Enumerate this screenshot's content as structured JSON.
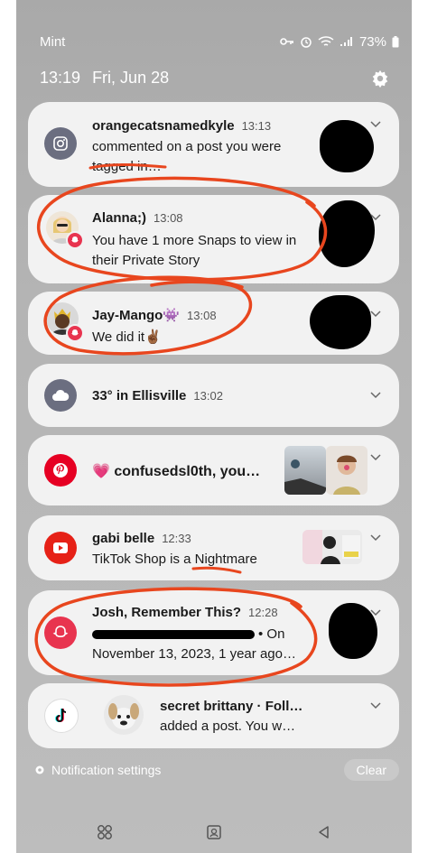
{
  "status_bar": {
    "carrier": "Mint",
    "battery": "73%"
  },
  "header": {
    "time": "13:19",
    "date": "Fri, Jun 28"
  },
  "notifications": [
    {
      "title": "orangecatsnamedkyle",
      "time": "13:13",
      "body": "commented on a post you were tagged in…",
      "app_icon": "instagram-icon"
    },
    {
      "title": "Alanna;)",
      "time": "13:08",
      "body": "You have 1 more Snaps to view in their Private Story",
      "app_icon": "snapchat-icon"
    },
    {
      "title": "Jay-Mango👾",
      "time": "13:08",
      "body": "We did it✌🏾",
      "app_icon": "snapchat-icon"
    },
    {
      "title": "33° in Ellisville",
      "time": "13:02",
      "body": "",
      "app_icon": "cloud-icon"
    },
    {
      "title": "💗 confusedsl0th, you…",
      "time": "",
      "body": "",
      "app_icon": "pinterest-icon"
    },
    {
      "title": "gabi belle",
      "time": "12:33",
      "body": "TikTok Shop is a Nightmare",
      "app_icon": "youtube-icon"
    },
    {
      "title": "Josh, Remember This?",
      "time": "12:28",
      "body_line1": "• On",
      "body_line2": "November 13, 2023, 1 year ago…",
      "app_icon": "snapchat-icon"
    },
    {
      "title": "secret brittany · Foll…",
      "time": "",
      "body": "added a post. You w…",
      "app_icon": "tiktok-icon"
    }
  ],
  "footer": {
    "settings_label": "Notification settings",
    "clear_label": "Clear"
  },
  "colors": {
    "annotation": "#e8461e",
    "instagram": "#6b6e80",
    "snapchat": "#e8344f",
    "pinterest": "#e60023",
    "youtube": "#e62117"
  }
}
